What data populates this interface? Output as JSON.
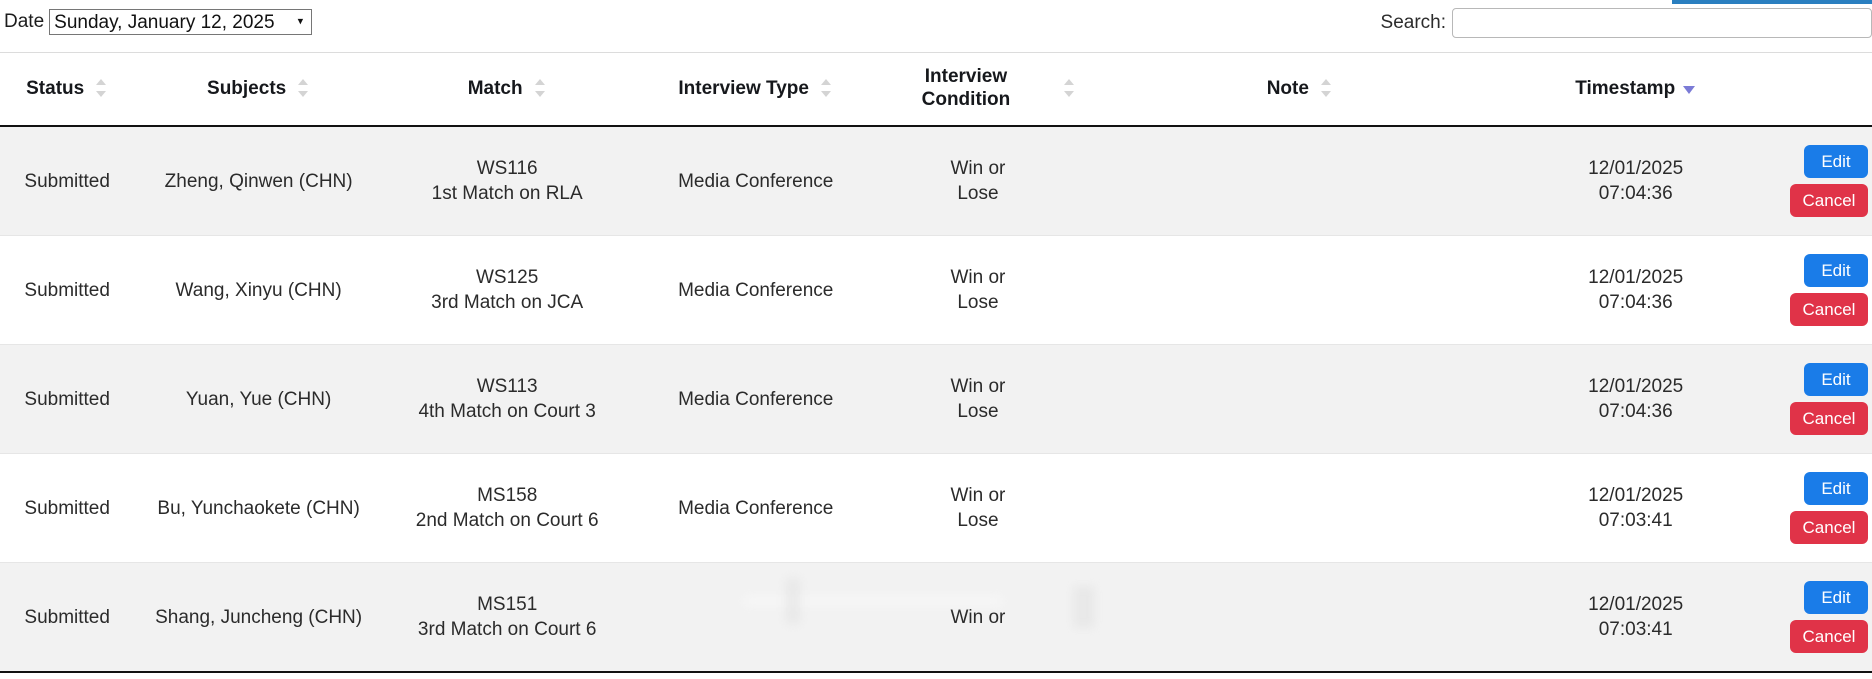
{
  "controls": {
    "date_label": "Date",
    "date_value": "Sunday, January 12, 2025",
    "date_caret_icon": "chevron-down-icon",
    "search_label": "Search:",
    "search_value": "",
    "search_placeholder": ""
  },
  "table": {
    "columns": [
      {
        "label": "Status",
        "sort": "none"
      },
      {
        "label": "Subjects",
        "sort": "none"
      },
      {
        "label": "Match",
        "sort": "none"
      },
      {
        "label": "Interview Type",
        "sort": "none"
      },
      {
        "label": "Interview Condition",
        "sort": "none"
      },
      {
        "label": "Note",
        "sort": "none"
      },
      {
        "label": "Timestamp",
        "sort": "desc"
      }
    ],
    "rows": [
      {
        "status": "Submitted",
        "subject": "Zheng, Qinwen (CHN)",
        "match_code": "WS116",
        "match_detail": "1st Match on RLA",
        "interview_type": "Media Conference",
        "condition_line1": "Win or",
        "condition_line2": "Lose",
        "note": "",
        "timestamp_date": "12/01/2025",
        "timestamp_time": "07:04:36",
        "edit_label": "Edit",
        "cancel_label": "Cancel"
      },
      {
        "status": "Submitted",
        "subject": "Wang, Xinyu (CHN)",
        "match_code": "WS125",
        "match_detail": "3rd Match on JCA",
        "interview_type": "Media Conference",
        "condition_line1": "Win or",
        "condition_line2": "Lose",
        "note": "",
        "timestamp_date": "12/01/2025",
        "timestamp_time": "07:04:36",
        "edit_label": "Edit",
        "cancel_label": "Cancel"
      },
      {
        "status": "Submitted",
        "subject": "Yuan, Yue (CHN)",
        "match_code": "WS113",
        "match_detail": "4th Match on Court 3",
        "interview_type": "Media Conference",
        "condition_line1": "Win or",
        "condition_line2": "Lose",
        "note": "",
        "timestamp_date": "12/01/2025",
        "timestamp_time": "07:04:36",
        "edit_label": "Edit",
        "cancel_label": "Cancel"
      },
      {
        "status": "Submitted",
        "subject": "Bu, Yunchaokete (CHN)",
        "match_code": "MS158",
        "match_detail": "2nd Match on Court 6",
        "interview_type": "Media Conference",
        "condition_line1": "Win or",
        "condition_line2": "Lose",
        "note": "",
        "timestamp_date": "12/01/2025",
        "timestamp_time": "07:03:41",
        "edit_label": "Edit",
        "cancel_label": "Cancel"
      },
      {
        "status": "Submitted",
        "subject": "Shang, Juncheng (CHN)",
        "match_code": "MS151",
        "match_detail": "3rd Match on Court 6",
        "interview_type": "",
        "condition_line1": "Win or",
        "condition_line2": "",
        "note": "",
        "timestamp_date": "12/01/2025",
        "timestamp_time": "07:03:41",
        "edit_label": "Edit",
        "cancel_label": "Cancel"
      }
    ]
  },
  "colors": {
    "edit_button": "#1a7ce8",
    "cancel_button": "#e03348",
    "active_sort_arrow": "#7b7bd6",
    "row_stripe": "#f2f2f2",
    "top_strip": "#2a7fc0"
  }
}
